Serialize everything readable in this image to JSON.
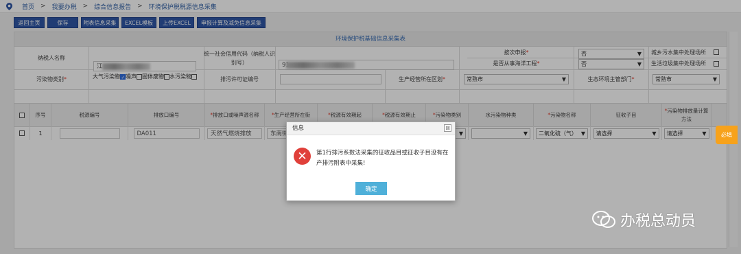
{
  "breadcrumb": {
    "items": [
      "首页",
      "我要办税",
      "综合信息报告",
      "环境保护税税源信息采集"
    ],
    "separator": ">"
  },
  "toolbar": {
    "buttons": [
      "返回主页",
      "保存",
      "附表信息采集",
      "EXCEL模板",
      "上传EXCEL",
      "申报计算及减免信息采集"
    ]
  },
  "form": {
    "title": "环境保护税基础信息采集表",
    "taxpayer_name_label": "纳税人名称",
    "taxpayer_name_value": "江",
    "credit_code_label": "统一社会信用代码（纳税人识别号）",
    "credit_code_value": "91",
    "per_period_label": "按次申报",
    "per_period_value": "否",
    "marine_label": "是否从事海洋工程",
    "marine_value": "否",
    "urban_sewage_label": "城乡污水集中处理场所",
    "domestic_waste_label": "生活垃圾集中处理场所",
    "pollutant_type_label": "污染物类别",
    "pollutant_options": {
      "air": "大气污染物",
      "noise": "噪声",
      "solid": "固体废物",
      "water": "水污染物"
    },
    "permit_label": "排污许可证编号",
    "permit_value": "",
    "district_label": "生产经营所在区划",
    "district_value": "常熟市",
    "env_dept_label": "生态环境主管部门",
    "env_dept_value": "常熟市"
  },
  "table": {
    "headers": [
      "序号",
      "税源编号",
      "排放口编号",
      "排放口或噪声源名称",
      "生产经营所在街",
      "税源有效期起",
      "税源有效期止",
      "污染物类别",
      "水污染物种类",
      "污染物名称",
      "征收子目",
      "污染物排放量计算方法"
    ],
    "row": {
      "index": "1",
      "source_no": "",
      "outlet_no": "DA011",
      "outlet_name": "天然气燃烧排放",
      "street": "东南街",
      "pollutant_name": "二氧化硫（气）",
      "sub_item": "请选择",
      "calc_method": "请选择"
    },
    "required_tag": "必填"
  },
  "modal": {
    "title": "信息",
    "close_glyph": "⊠",
    "message": "第1行排污系数法采集的征收品目或征收子目没有在产排污附表中采集!",
    "ok_label": "确定"
  },
  "watermark": {
    "text": "办税总动员"
  },
  "colors": {
    "accent": "#2e57a6",
    "error": "#e0403a",
    "ok_button": "#4fb0d9",
    "required_tag": "#f7a21b"
  }
}
